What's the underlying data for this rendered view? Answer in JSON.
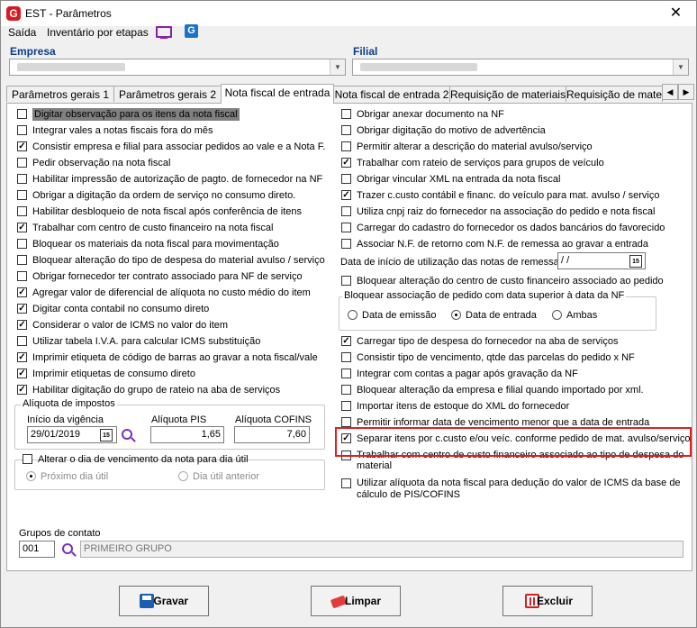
{
  "window": {
    "title": "EST - Parâmetros",
    "close_glyph": "✕",
    "app_icon": "G"
  },
  "menu": {
    "items": [
      "Saída",
      "Inventário por etapas"
    ],
    "icons": [
      "monitor-icon",
      "g-app-icon"
    ],
    "g_icon_text": "G"
  },
  "header": {
    "empresa_label": "Empresa",
    "filial_label": "Filial"
  },
  "tabs": [
    "Parâmetros gerais 1",
    "Parâmetros gerais 2",
    "Nota fiscal de entrada",
    "Nota fiscal de entrada 2",
    "Requisição de materiais",
    "Requisição de materi"
  ],
  "tab_scroll": {
    "left": "◀",
    "right": "▶"
  },
  "left_checks": [
    {
      "label": "Digitar observação para os itens da nota fiscal",
      "checked": false
    },
    {
      "label": "Integrar vales a notas fiscais fora do mês",
      "checked": false
    },
    {
      "label": "Consistir empresa e filial para associar pedidos ao vale e a Nota F.",
      "checked": true
    },
    {
      "label": "Pedir observação na nota fiscal",
      "checked": false
    },
    {
      "label": "Habilitar impressão de autorização de pagto. de fornecedor na NF",
      "checked": false
    },
    {
      "label": "Obrigar a digitação da ordem de serviço no consumo direto.",
      "checked": false
    },
    {
      "label": "Habilitar desbloqueio de nota fiscal após conferência de itens",
      "checked": false
    },
    {
      "label": "Trabalhar com centro de custo financeiro na nota fiscal",
      "checked": true
    },
    {
      "label": "Bloquear os materiais da nota fiscal para movimentação",
      "checked": false
    },
    {
      "label": "Bloquear alteração do tipo de despesa do material avulso / serviço",
      "checked": false
    },
    {
      "label": "Obrigar fornecedor ter contrato associado para NF de serviço",
      "checked": false
    },
    {
      "label": "Agregar valor de diferencial de alíquota no custo médio do item",
      "checked": true
    },
    {
      "label": "Digitar conta contabil no consumo direto",
      "checked": true
    },
    {
      "label": "Considerar o valor de ICMS no valor do item",
      "checked": true
    },
    {
      "label": "Utilizar tabela I.V.A. para calcular ICMS substituição",
      "checked": false
    },
    {
      "label": "Imprimir etiqueta de código de barras ao gravar a nota fiscal/vale",
      "checked": true
    },
    {
      "label": "Imprimir etiquetas de consumo direto",
      "checked": true
    },
    {
      "label": "Habilitar digitação do grupo de rateio na aba de serviços",
      "checked": true
    }
  ],
  "aliquota": {
    "title": "Alíquota de impostos",
    "inicio_label": "Início da vigência",
    "inicio_value": "29/01/2019",
    "cal_text": "15",
    "pis_label": "Alíquota PIS",
    "pis_value": "1,65",
    "cofins_label": "Alíquota COFINS",
    "cofins_value": "7,60"
  },
  "vencimento": {
    "check_label": "Alterar o dia de vencimento da nota para dia útil",
    "checked": false,
    "opt1": "Próximo dia útil",
    "opt2": "Dia útil anterior"
  },
  "grupos": {
    "label": "Grupos de contato",
    "code": "001",
    "name": "PRIMEIRO GRUPO"
  },
  "right_checks_a": [
    {
      "label": "Obrigar anexar documento na NF",
      "checked": false
    },
    {
      "label": "Obrigar digitação do motivo de advertência",
      "checked": false
    },
    {
      "label": "Permitir alterar a descrição do material avulso/serviço",
      "checked": false
    },
    {
      "label": "Trabalhar com rateio de serviços para grupos de veículo",
      "checked": true
    },
    {
      "label": "Obrigar vincular XML na entrada da nota fiscal",
      "checked": false
    },
    {
      "label": "Trazer c.custo contábil e financ. do veículo para mat. avulso / serviço",
      "checked": true
    },
    {
      "label": "Utiliza cnpj raiz do fornecedor na associação do pedido e nota fiscal",
      "checked": false
    },
    {
      "label": "Carregar do cadastro do fornecedor os dados bancários do favorecido",
      "checked": false
    },
    {
      "label": "Associar N.F. de retorno com N.F. de remessa ao gravar a entrada",
      "checked": false
    }
  ],
  "data_inicio": {
    "label": "Data de início de utilização das notas de remessa",
    "value": " /  /",
    "cal_text": "15"
  },
  "bloquear_cc": {
    "label": "Bloquear alteração do centro de custo financeiro associado ao pedido",
    "checked": false
  },
  "bloq_pedido": {
    "title": "Bloquear associação de pedido com data superior à data da NF",
    "options": [
      "Data de emissão",
      "Data de entrada",
      "Ambas"
    ],
    "selected_index": 1
  },
  "right_checks_b": [
    {
      "label": "Carregar tipo de despesa do fornecedor na aba de serviços",
      "checked": true
    },
    {
      "label": "Consistir tipo de vencimento, qtde das parcelas do pedido x NF",
      "checked": false
    },
    {
      "label": "Integrar com contas a pagar após gravação da NF",
      "checked": false
    },
    {
      "label": "Bloquear alteração da empresa e filial quando importado por xml.",
      "checked": false
    },
    {
      "label": "Importar itens de estoque do XML do fornecedor",
      "checked": false
    },
    {
      "label": "Permitir informar data de vencimento menor que a data de entrada",
      "checked": false
    },
    {
      "label": "Separar itens por c.custo e/ou veíc. conforme pedido de mat. avulso/serviço",
      "checked": true
    }
  ],
  "right_multiline": [
    {
      "line1": "Trabalhar com centro de custo financeiro associado ao tipo de despesa do",
      "line2": "material",
      "checked": false
    },
    {
      "line1": "Utilizar alíquota da nota fiscal para dedução do valor de ICMS da base de",
      "line2": "cálculo de PIS/COFINS",
      "checked": false
    }
  ],
  "buttons": {
    "save": "Gravar",
    "clear": "Limpar",
    "delete": "Excluir"
  }
}
